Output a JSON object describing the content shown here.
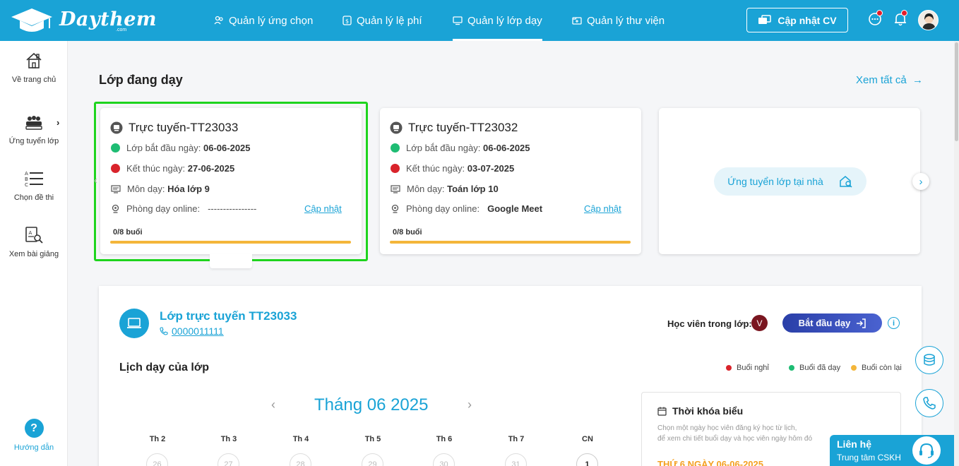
{
  "header": {
    "logo_text": "Daythem",
    "logo_sub": ".com",
    "nav": [
      {
        "label": "Quản lý ứng chọn",
        "icon": "users-icon"
      },
      {
        "label": "Quản lý lệ phí",
        "icon": "fee-icon"
      },
      {
        "label": "Quản lý lớp dạy",
        "icon": "class-icon",
        "active": true
      },
      {
        "label": "Quản lý thư viện",
        "icon": "library-icon"
      }
    ],
    "cv_button": "Cập nhật CV"
  },
  "sidebar": {
    "items": [
      {
        "label": "Về trang chủ",
        "icon": "home-icon"
      },
      {
        "label": "Ứng tuyển lớp",
        "icon": "group-icon"
      },
      {
        "label": "Chọn đề thi",
        "icon": "exam-list-icon"
      },
      {
        "label": "Xem bài giảng",
        "icon": "lecture-icon"
      }
    ],
    "help_label": "Hướng dẫn",
    "help_symbol": "?"
  },
  "main": {
    "section_title": "Lớp đang dạy",
    "see_all": "Xem tất cả",
    "cards": [
      {
        "title": "Trực tuyến-TT23033",
        "start_label": "Lớp bắt đầu ngày:",
        "start_date": "06-06-2025",
        "end_label": "Kết thúc ngày:",
        "end_date": "27-06-2025",
        "subject_label": "Môn dạy:",
        "subject": "Hóa lớp 9",
        "room_label": "Phòng dạy online:",
        "room": "----------------",
        "update": "Cập nhật",
        "sessions": "0/8 buổi"
      },
      {
        "title": "Trực tuyến-TT23032",
        "start_label": "Lớp bắt đầu ngày:",
        "start_date": "06-06-2025",
        "end_label": "Kết thúc ngày:",
        "end_date": "03-07-2025",
        "subject_label": "Môn dạy:",
        "subject": "Toán lớp 10",
        "room_label": "Phòng dạy online:",
        "room": "Google Meet",
        "update": "Cập nhật",
        "sessions": "0/8 buổi"
      }
    ],
    "apply_home": "Ứng tuyển lớp tại nhà"
  },
  "detail": {
    "class_name": "Lớp trực tuyến TT23033",
    "phone": "0000011111",
    "students_label": "Học viên trong lớp:",
    "student_initial": "V",
    "start_button": "Bắt đầu dạy",
    "schedule_title": "Lịch dạy của lớp",
    "legend": [
      {
        "label": "Buổi nghỉ",
        "color": "#d9232b"
      },
      {
        "label": "Buổi đã dạy",
        "color": "#1ebc73"
      },
      {
        "label": "Buổi còn lại",
        "color": "#f4b63a"
      }
    ],
    "month": "Tháng 06 2025",
    "weekdays": [
      "Th 2",
      "Th 3",
      "Th 4",
      "Th 5",
      "Th 6",
      "Th 7",
      "CN"
    ],
    "days": [
      "26",
      "27",
      "28",
      "29",
      "30",
      "31",
      "1"
    ],
    "timetable": {
      "title": "Thời khóa biểu",
      "desc_line1": "Chọn một ngày học viên đăng ký học từ lịch,",
      "desc_line2": "để xem chi tiết buổi dạy và học viên ngày hôm đó",
      "date": "THỨ 6 NGÀY 06-06-2025"
    }
  },
  "contact": {
    "title": "Liên hệ",
    "subtitle": "Trung tâm CSKH"
  },
  "colors": {
    "brand": "#1aa3d6",
    "green": "#1ebc73",
    "red": "#d9232b",
    "progress": "#f4b63a",
    "highlight": "#1ed41e"
  }
}
